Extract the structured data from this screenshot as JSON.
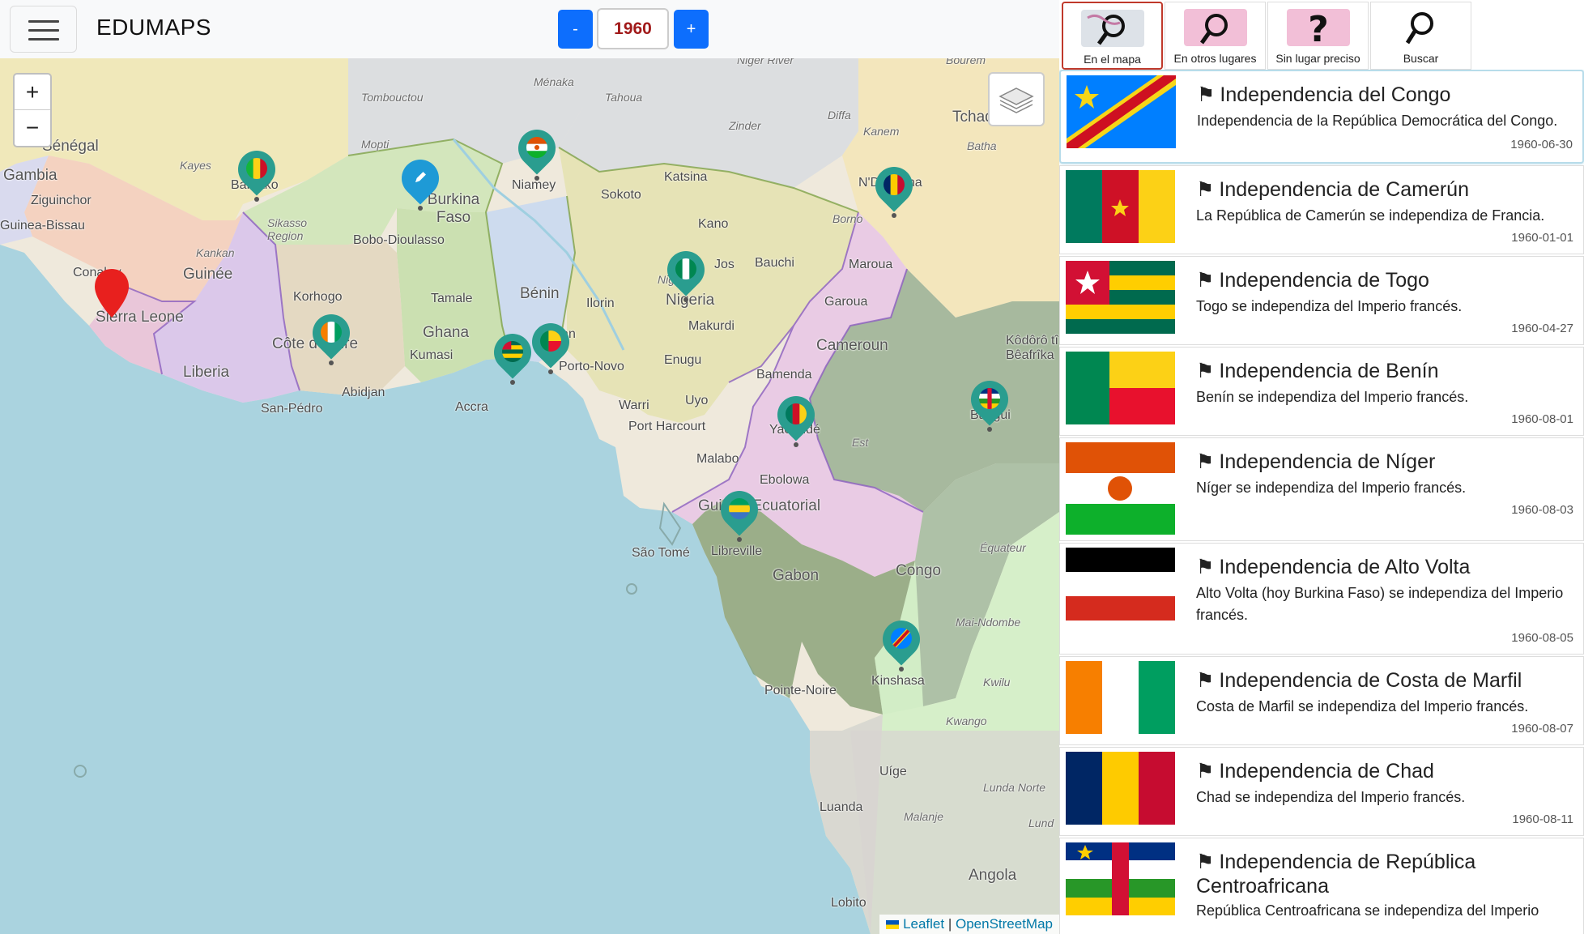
{
  "header": {
    "brand": "EDUMAPS",
    "year": "1960",
    "minus_label": "-",
    "plus_label": "+"
  },
  "tabs": [
    {
      "label": "En el mapa",
      "icon": "world-magnifier-icon",
      "active": true
    },
    {
      "label": "En otros lugares",
      "icon": "world-magnifier-pink-icon",
      "active": false
    },
    {
      "label": "Sin lugar preciso",
      "icon": "world-question-icon",
      "active": false
    },
    {
      "label": "Buscar",
      "icon": "magnifier-search-icon",
      "active": false
    }
  ],
  "map": {
    "zoom_in": "+",
    "zoom_out": "−",
    "attribution": {
      "leaflet": "Leaflet",
      "sep": " | ",
      "osm": "OpenStreetMap"
    },
    "labels": [
      "Sénégal",
      "Gambia",
      "Ziguinchor",
      "Guinea-Bissau",
      "Kayes",
      "Bamako",
      "Sikasso Region",
      "Kankan",
      "Guinée",
      "Conakry",
      "Sierra Leone",
      "Liberia",
      "Korhogo",
      "Côte d'Ivoire",
      "Abidjan",
      "San-Pédro",
      "Burkina Faso",
      "Bobo-Dioulasso",
      "Mopti",
      "Tombouctou",
      "Ménaka",
      "Tahoua",
      "Niger",
      "Zinder",
      "Diffa",
      "Niamey",
      "Sokoto",
      "Katsina",
      "Kano",
      "Bauchi",
      "Jos",
      "Nigeria",
      "Ilorin",
      "Ibadan",
      "Porto-Novo",
      "Bénin",
      "Tamale",
      "Ghana",
      "Kumasi",
      "Accra",
      "Enugu",
      "Makurdi",
      "Uyo",
      "Warri",
      "Port Harcourt",
      "Bamenda",
      "Cameroun",
      "Garoua",
      "Maroua",
      "Yaoundé",
      "Est",
      "Malabo",
      "Ebolowa",
      "Guinea Ecuatorial",
      "Libreville",
      "São Tomé",
      "Gabon",
      "Congo",
      "Pointe-Noire",
      "Kinshasa",
      "Équateur",
      "Mai-Ndombe",
      "Kwilu",
      "Kwango",
      "Uíge",
      "Luanda",
      "Malanje",
      "Lunda Norte",
      "Lund",
      "Angola",
      "Lobito",
      "Kanem",
      "Batha",
      "Tchad",
      "Borno",
      "N'Djamena",
      "Bangui",
      "Kôdôrô tî Bêafrîka",
      "Bourem",
      "Niger River"
    ]
  },
  "events": [
    {
      "title": "Independencia del Congo",
      "desc": "Independencia de la República Democrática del Congo.",
      "date": "1960-06-30",
      "flag": "drc-flag"
    },
    {
      "title": "Independencia de Camerún",
      "desc": "La República de Camerún se independiza de Francia.",
      "date": "1960-01-01",
      "flag": "cameroon-flag"
    },
    {
      "title": "Independencia de Togo",
      "desc": "Togo se independiza del Imperio francés.",
      "date": "1960-04-27",
      "flag": "togo-flag"
    },
    {
      "title": "Independencia de Benín",
      "desc": "Benín se independiza del Imperio francés.",
      "date": "1960-08-01",
      "flag": "benin-flag"
    },
    {
      "title": "Independencia de Níger",
      "desc": "Níger se independiza del Imperio francés.",
      "date": "1960-08-03",
      "flag": "niger-flag"
    },
    {
      "title": "Independencia de Alto Volta",
      "desc": "Alto Volta (hoy Burkina Faso) se independiza del Imperio francés.",
      "date": "1960-08-05",
      "flag": "upper-volta-flag"
    },
    {
      "title": "Independencia de Costa de Marfil",
      "desc": "Costa de Marfil se independiza del Imperio francés.",
      "date": "1960-08-07",
      "flag": "ivory-coast-flag"
    },
    {
      "title": "Independencia de Chad",
      "desc": "Chad se independiza del Imperio francés.",
      "date": "1960-08-11",
      "flag": "chad-flag"
    },
    {
      "title": "Independencia de República Centroafricana",
      "desc": "República Centroafricana se independiza del Imperio",
      "date": "",
      "flag": "car-flag"
    }
  ]
}
